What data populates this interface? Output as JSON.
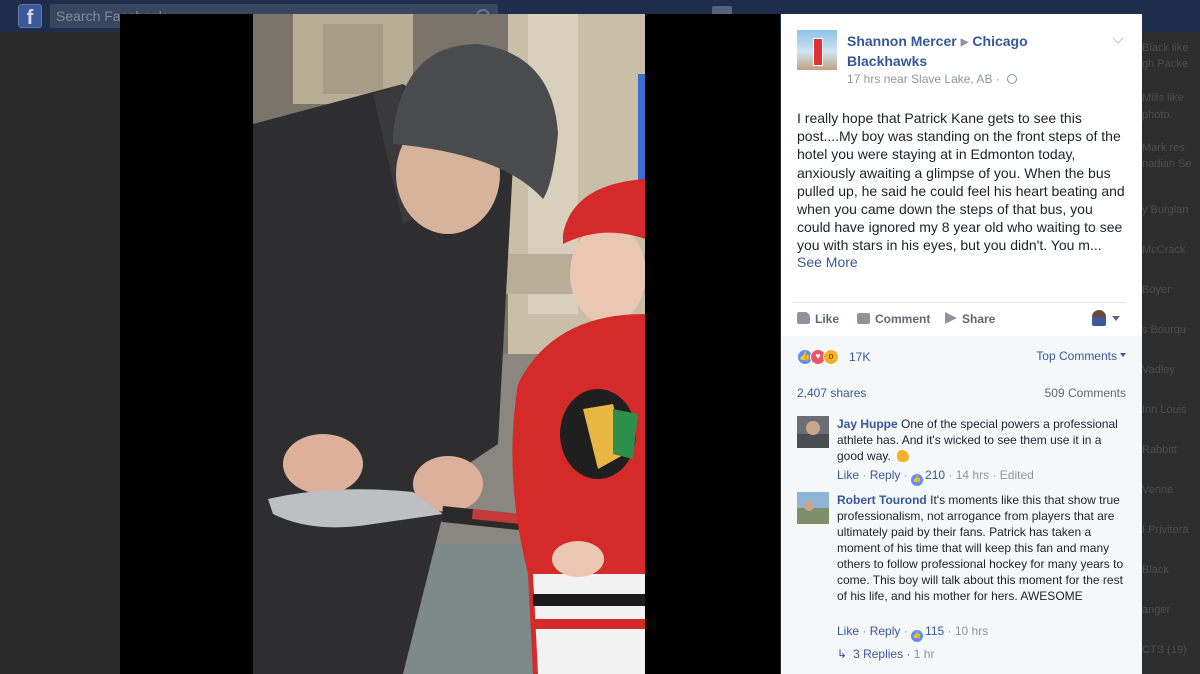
{
  "topbar": {
    "search_placeholder": "Search Facebook",
    "logo_icon": "facebook-logo-icon"
  },
  "sidechat": {
    "items": [
      "Black like",
      "gh Packe",
      "Mills like",
      "photo.",
      "Mark res",
      "nadian Se",
      "y Burglan",
      "McCrack",
      "Boyer",
      "s Bourqu",
      "Vadley",
      "Inn Louis",
      "Rabbitt",
      "Venne",
      "I Privitera",
      "Black",
      "anger",
      "CTS (19)"
    ]
  },
  "post": {
    "author": "Shannon Mercer",
    "target": "Chicago Blackhawks",
    "meta_time": "17 hrs",
    "meta_location": "near Slave Lake, AB",
    "separator": "·",
    "body": "I really hope that Patrick Kane gets to see this post....My boy was standing on the front steps of the hotel you were staying at in Edmonton today, anxiously awaiting a glimpse of you. When the bus pulled up, he said he could feel his heart beating and when you came down the steps of that bus, you could have ignored my 8 year old who waiting to see you with stars in his eyes, but you didn't. You m...",
    "see_more": "See More",
    "actions": {
      "like": "Like",
      "comment": "Comment",
      "share": "Share"
    },
    "reaction_count": "17K",
    "top_comments": "Top Comments",
    "shares": "2,407 shares",
    "comments_count": "509 Comments"
  },
  "comments": [
    {
      "name": "Jay Huppe",
      "text": "One of the special powers a professional athlete has. And it's wicked to see them use it in a good way.",
      "like": "Like",
      "reply": "Reply",
      "likes": "210",
      "time": "14 hrs",
      "edited": "Edited"
    },
    {
      "name": "Robert Tourond",
      "text": "It's moments like this that show true professionalism, not arrogance from players that are ultimately paid by their fans. Patrick has taken a moment of his time that will keep this fan and many others to follow professional hockey for many years to come. This boy will talk about this moment for the rest of his life, and his mother for hers. AWESOME",
      "like": "Like",
      "reply": "Reply",
      "likes": "115",
      "time": "10 hrs"
    }
  ],
  "replies": {
    "label": "3 Replies",
    "time": "1 hr"
  },
  "colors": {
    "link": "#365899",
    "topbar": "#1f2d4d",
    "like_blue": "#5890ff",
    "love_red": "#f25268",
    "wow_yellow": "#f7b125"
  }
}
